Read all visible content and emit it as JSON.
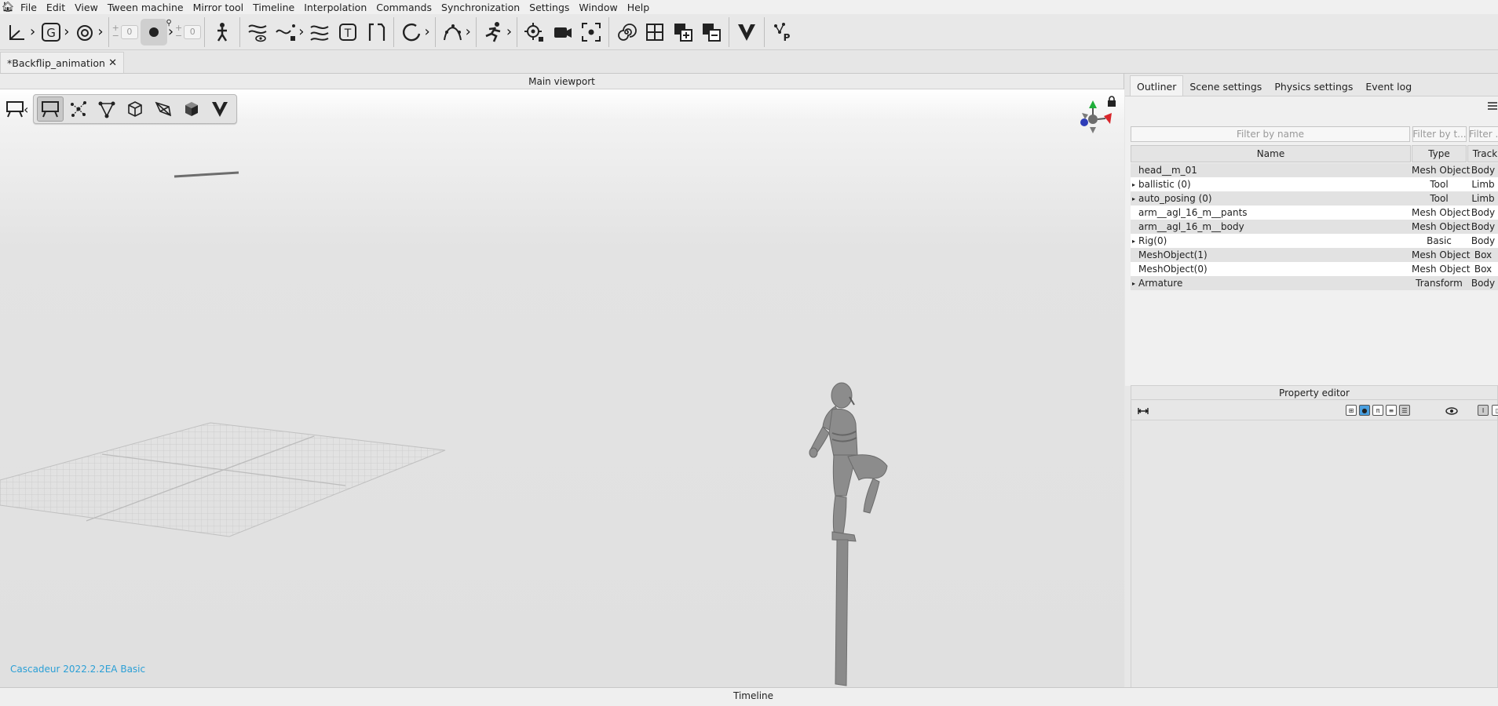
{
  "menu": {
    "items": [
      "File",
      "Edit",
      "View",
      "Tween machine",
      "Mirror tool",
      "Timeline",
      "Interpolation",
      "Commands",
      "Synchronization",
      "Settings",
      "Window",
      "Help"
    ]
  },
  "toolbar": {
    "spin_left_value": "0",
    "spin_right_value": "0",
    "icons": [
      "axis-icon",
      "group-g-icon",
      "rotate-icon",
      "record-icon",
      "figure-icon",
      "curves-eye-icon",
      "curve-lock-icon",
      "curves-check-icon",
      "text-t-icon",
      "bracket-icon",
      "loop-icon",
      "path-icon",
      "run-icon",
      "target-lock-icon",
      "camera-icon",
      "focus-icon",
      "spiral-icon",
      "grid-icon",
      "add-layer-icon",
      "remove-layer-icon",
      "v-logo-icon",
      "physics-p-icon"
    ]
  },
  "document_tab": {
    "title": "*Backflip_animation",
    "close": "✕"
  },
  "viewport": {
    "title": "Main viewport",
    "version_text": "Cascadeur 2022.2.2EA Basic"
  },
  "panel": {
    "tabs": [
      "Outliner",
      "Scene settings",
      "Physics settings",
      "Event log"
    ],
    "filters": {
      "name_placeholder": "Filter by name",
      "type_placeholder": "Filter by t...",
      "track_placeholder": "Filter ..."
    },
    "columns": [
      "Name",
      "Type",
      "Track"
    ],
    "rows": [
      {
        "name": "head__m_01",
        "type": "Mesh Object",
        "track": "Body",
        "expandable": false
      },
      {
        "name": "ballistic (0)",
        "type": "Tool",
        "track": "Limb",
        "expandable": true
      },
      {
        "name": "auto_posing (0)",
        "type": "Tool",
        "track": "Limb",
        "expandable": true
      },
      {
        "name": "arm__agl_16_m__pants",
        "type": "Mesh Object",
        "track": "Body",
        "expandable": false
      },
      {
        "name": "arm__agl_16_m__body",
        "type": "Mesh Object",
        "track": "Body",
        "expandable": false
      },
      {
        "name": "Rig(0)",
        "type": "Basic",
        "track": "Body",
        "expandable": true
      },
      {
        "name": "MeshObject(1)",
        "type": "Mesh Object",
        "track": "Box",
        "expandable": false
      },
      {
        "name": "MeshObject(0)",
        "type": "Mesh Object",
        "track": "Box",
        "expandable": false
      },
      {
        "name": "Armature",
        "type": "Transform",
        "track": "Body",
        "expandable": true
      }
    ],
    "property_editor_title": "Property editor"
  },
  "timeline": {
    "title": "Timeline"
  },
  "colors": {
    "accent_link": "#2a9fd6",
    "gizmo_green": "#1fae3a",
    "gizmo_red": "#d8262b",
    "gizmo_blue": "#2d3cb8"
  }
}
